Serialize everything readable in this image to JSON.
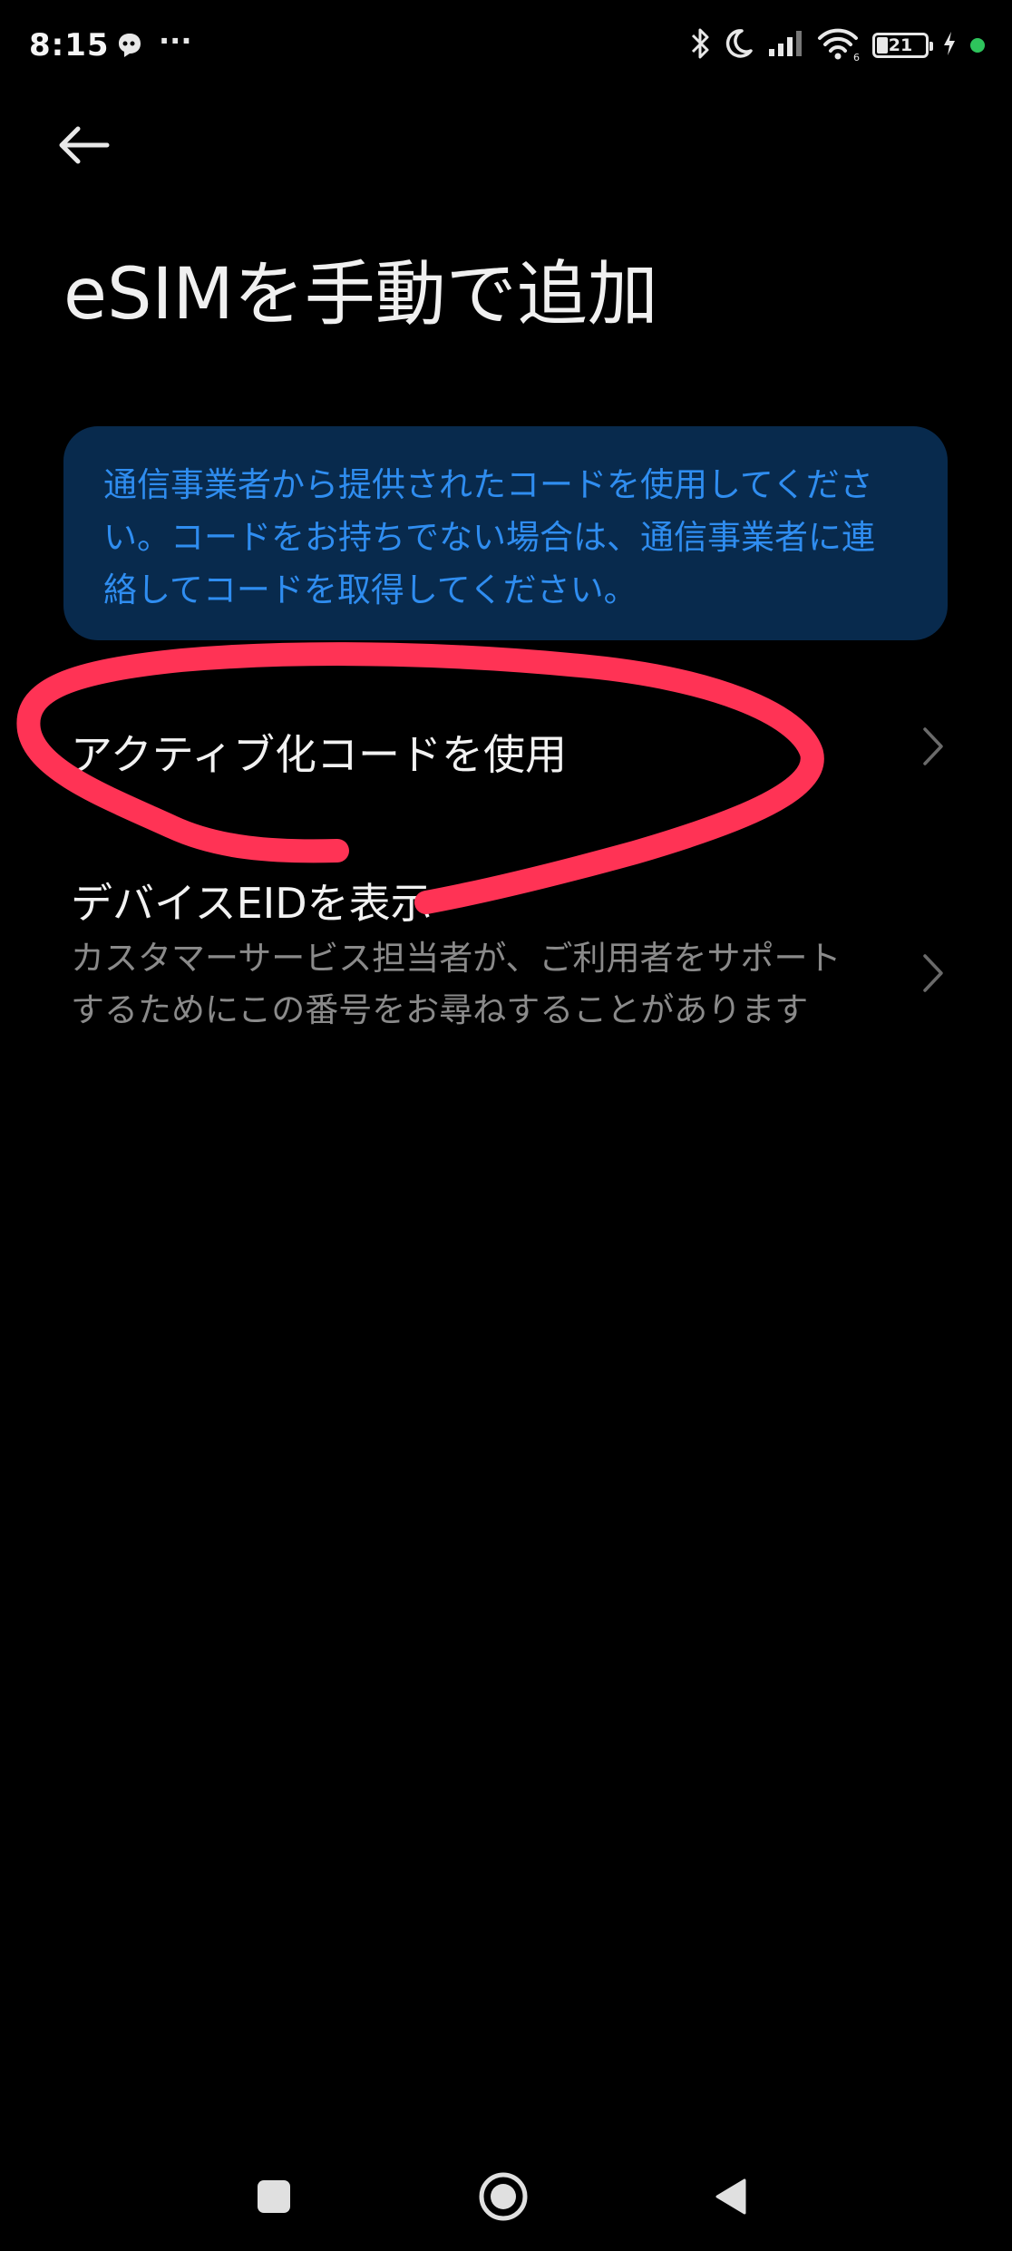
{
  "status_bar": {
    "time": "8:15",
    "more": "···",
    "battery_level": "21",
    "accent_colors": {
      "charging_dot": "#2ec45c"
    },
    "icons": [
      "messenger-icon",
      "more-dots-icon",
      "bluetooth-icon",
      "moon-icon",
      "signal-icon",
      "wifi-icon",
      "battery-icon",
      "charging-bolt-icon",
      "privacy-dot-icon"
    ]
  },
  "header": {
    "title": "eSIMを手動で追加"
  },
  "info_card": {
    "text": "通信事業者から提供されたコードを使用してください。コードをお持ちでない場合は、通信事業者に連絡してコードを取得してください。",
    "text_color": "#2f8df0",
    "background_color": "#082a4d"
  },
  "list": {
    "items": [
      {
        "title": "アクティブ化コードを使用"
      },
      {
        "title": "デバイスEIDを表示",
        "subtitle": "カスタマーサービス担当者が、ご利用者をサポートするためにこの番号をお尋ねすることがあります"
      }
    ]
  },
  "annotation": {
    "color": "#ff3355"
  },
  "nav_bar": {
    "icons": [
      "recents-square-icon",
      "home-circle-icon",
      "back-triangle-icon"
    ]
  }
}
